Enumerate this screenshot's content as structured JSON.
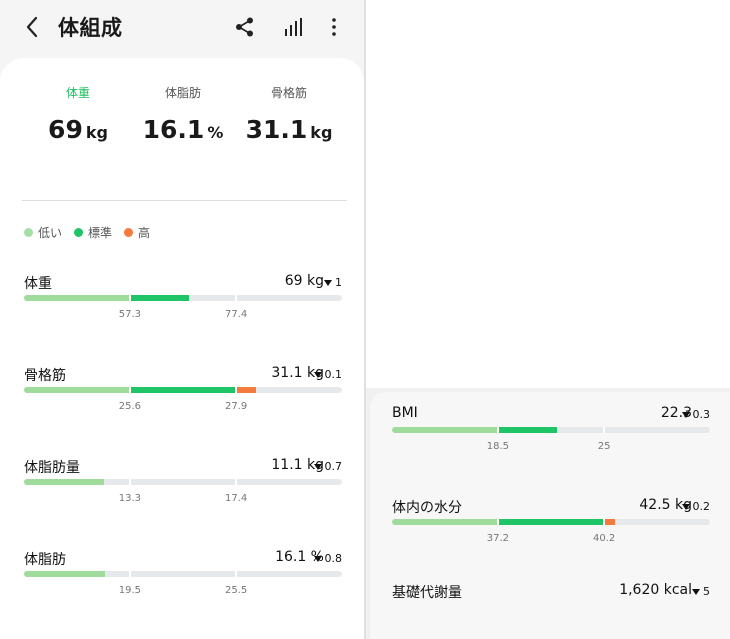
{
  "header": {
    "title": "体組成",
    "icons": [
      "back-icon",
      "share-icon",
      "bar-chart-icon",
      "more-vert-icon"
    ]
  },
  "summary": [
    {
      "label": "体重",
      "value": "69",
      "unit": "kg",
      "active": true
    },
    {
      "label": "体脂肪",
      "value": "16.1",
      "unit": "%",
      "active": false
    },
    {
      "label": "骨格筋",
      "value": "31.1",
      "unit": "kg",
      "active": false
    }
  ],
  "legend": [
    {
      "label": "低い",
      "color": "#a5dea6"
    },
    {
      "label": "標準",
      "color": "#1ec466"
    },
    {
      "label": "高",
      "color": "#f47a3d"
    }
  ],
  "colors": {
    "low": "#9fdc9b",
    "normal": "#1ec466",
    "high": "#f47a3d",
    "track": "#e6e9ec"
  },
  "metrics_left": [
    {
      "name": "体重",
      "value": "69 kg",
      "delta": "1",
      "ticks": [
        "57.3",
        "77.4"
      ],
      "low_fraction": 0.33,
      "normal_fraction": 0.52,
      "high_fraction": 0
    },
    {
      "name": "骨格筋",
      "value": "31.1 kg",
      "delta": "0.1",
      "ticks": [
        "25.6",
        "27.9"
      ],
      "low_fraction": 0.33,
      "normal_fraction": 0.67,
      "high_fraction": 0.73
    },
    {
      "name": "体脂肪量",
      "value": "11.1 kg",
      "delta": "0.7",
      "ticks": [
        "13.3",
        "17.4"
      ],
      "low_fraction": 0.25,
      "normal_fraction": 0,
      "high_fraction": 0
    },
    {
      "name": "体脂肪",
      "value": "16.1 %",
      "delta": "0.8",
      "ticks": [
        "19.5",
        "25.5"
      ],
      "low_fraction": 0.255,
      "normal_fraction": 0,
      "high_fraction": 0
    }
  ],
  "metrics_right": [
    {
      "name": "BMI",
      "value": "22.3",
      "delta": "0.3",
      "ticks": [
        "18.5",
        "25"
      ],
      "low_fraction": 0.33,
      "normal_fraction": 0.52,
      "high_fraction": 0
    },
    {
      "name": "体内の水分",
      "value": "42.5 kg",
      "delta": "0.2",
      "ticks": [
        "37.2",
        "40.2"
      ],
      "low_fraction": 0.33,
      "normal_fraction": 0.67,
      "high_fraction": 0.7
    },
    {
      "name": "基礎代謝量",
      "value": "1,620 kcal",
      "delta": "5",
      "ticks": [],
      "low_fraction": 0,
      "normal_fraction": 0,
      "high_fraction": 0
    }
  ]
}
